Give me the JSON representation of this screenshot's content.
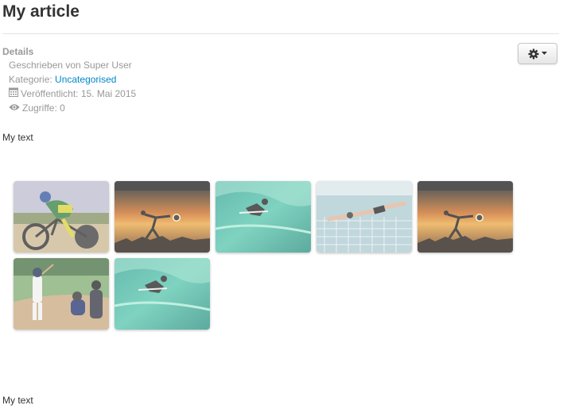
{
  "article": {
    "title": "My article",
    "details_heading": "Details",
    "author_line": "Geschrieben von Super User",
    "category_prefix": "Kategorie: ",
    "category_link": "Uncategorised",
    "published_line": "Veröffentlicht: 15. Mai 2015",
    "hits_line": "Zugriffe: 0",
    "body_text_top": "My text",
    "body_text_bottom": "My text"
  },
  "toolbar": {
    "gear_icon": "gear-icon",
    "caret_icon": "caret-down-icon"
  },
  "gallery": {
    "images": [
      {
        "subject": "cyclist"
      },
      {
        "subject": "sunset-kick"
      },
      {
        "subject": "surfer"
      },
      {
        "subject": "swimmer"
      },
      {
        "subject": "sunset-kick"
      },
      {
        "subject": "baseball"
      },
      {
        "subject": "surfer"
      }
    ]
  },
  "colors": {
    "link": "#0088cc",
    "muted_text": "#999999",
    "title_text": "#333333"
  }
}
